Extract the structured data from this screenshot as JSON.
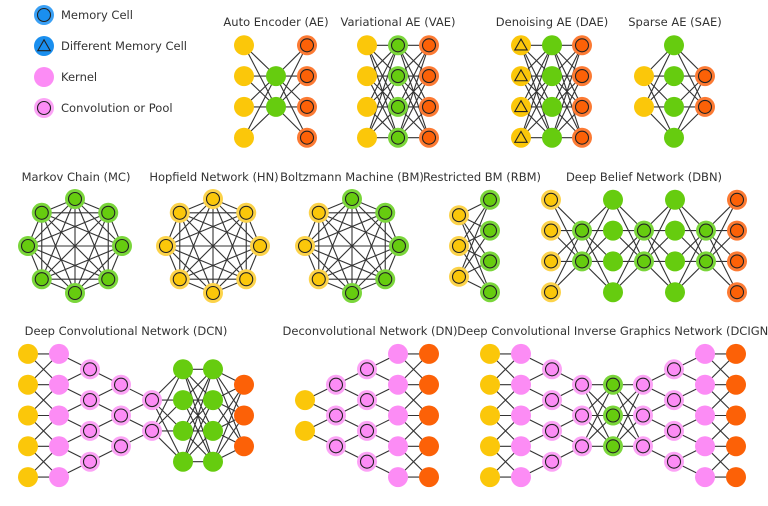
{
  "colors": {
    "memory": "#1a8fef",
    "memory_ring": "#3aa0f5",
    "kernel": "#fc8cf5",
    "conv_ring": "#fca3f6",
    "input": "#fbc70a",
    "hidden": "#66cc0f",
    "hidden_ring": "#7ad63a",
    "output": "#fc6107",
    "output_ring": "#fc7a33",
    "edge": "#333333",
    "text": "#333333"
  },
  "legend": [
    {
      "label": "Memory Cell",
      "type": "memory"
    },
    {
      "label": "Different Memory Cell",
      "type": "memory_tri"
    },
    {
      "label": "Kernel",
      "type": "kernel"
    },
    {
      "label": "Convolution or Pool",
      "type": "conv"
    }
  ],
  "networks": [
    {
      "id": "ae",
      "title": "Auto Encoder (AE)",
      "type": "layered",
      "layers": [
        {
          "type": "input",
          "count": 4
        },
        {
          "type": "hidden",
          "count": 2
        },
        {
          "type": "match_output",
          "count": 4
        }
      ]
    },
    {
      "id": "vae",
      "title": "Variational AE (VAE)",
      "type": "layered",
      "layers": [
        {
          "type": "input",
          "count": 4
        },
        {
          "type": "probabilistic_hidden",
          "count": 4
        },
        {
          "type": "match_output",
          "count": 4
        }
      ]
    },
    {
      "id": "dae",
      "title": "Denoising AE (DAE)",
      "type": "layered",
      "layers": [
        {
          "type": "noisy_input",
          "count": 4
        },
        {
          "type": "hidden",
          "count": 4
        },
        {
          "type": "match_output",
          "count": 4
        }
      ]
    },
    {
      "id": "sae",
      "title": "Sparse AE (SAE)",
      "type": "layered",
      "layers": [
        {
          "type": "input",
          "count": 2
        },
        {
          "type": "hidden",
          "count": 4
        },
        {
          "type": "match_output",
          "count": 2
        }
      ]
    },
    {
      "id": "mc",
      "title": "Markov Chain (MC)",
      "type": "ring",
      "nodes": [
        "probabilistic_hidden",
        "probabilistic_hidden",
        "probabilistic_hidden",
        "probabilistic_hidden",
        "probabilistic_hidden",
        "probabilistic_hidden",
        "probabilistic_hidden",
        "probabilistic_hidden"
      ]
    },
    {
      "id": "hn",
      "title": "Hopfield Network (HN)",
      "type": "ring",
      "nodes": [
        "backfed_input",
        "backfed_input",
        "backfed_input",
        "backfed_input",
        "backfed_input",
        "backfed_input",
        "backfed_input",
        "backfed_input"
      ]
    },
    {
      "id": "bm",
      "title": "Boltzmann Machine (BM)",
      "type": "ring",
      "nodes": [
        "probabilistic_hidden",
        "probabilistic_hidden",
        "probabilistic_hidden",
        "probabilistic_hidden",
        "probabilistic_hidden",
        "backfed_input",
        "backfed_input",
        "backfed_input"
      ]
    },
    {
      "id": "rbm",
      "title": "Restricted BM (RBM)",
      "type": "layered",
      "layers": [
        {
          "type": "backfed_input",
          "count": 3
        },
        {
          "type": "probabilistic_hidden",
          "count": 4
        }
      ]
    },
    {
      "id": "dbn",
      "title": "Deep Belief Network (DBN)",
      "type": "layered",
      "layers": [
        {
          "type": "backfed_input",
          "count": 4
        },
        {
          "type": "probabilistic_hidden",
          "count": 2
        },
        {
          "type": "hidden",
          "count": 4
        },
        {
          "type": "probabilistic_hidden",
          "count": 2
        },
        {
          "type": "hidden",
          "count": 4
        },
        {
          "type": "probabilistic_hidden",
          "count": 2
        },
        {
          "type": "match_output",
          "count": 4
        }
      ]
    },
    {
      "id": "dcn",
      "title": "Deep Convolutional Network (DCN)",
      "type": "layered",
      "layers": [
        {
          "type": "input",
          "count": 5
        },
        {
          "type": "kernel",
          "count": 5
        },
        {
          "type": "conv",
          "count": 4
        },
        {
          "type": "conv",
          "count": 3
        },
        {
          "type": "conv",
          "count": 2
        },
        {
          "type": "hidden",
          "count": 4
        },
        {
          "type": "hidden",
          "count": 4
        },
        {
          "type": "output",
          "count": 3
        }
      ]
    },
    {
      "id": "dn",
      "title": "Deconvolutional Network (DN)",
      "type": "layered",
      "layers": [
        {
          "type": "input",
          "count": 2
        },
        {
          "type": "conv",
          "count": 3
        },
        {
          "type": "conv",
          "count": 4
        },
        {
          "type": "kernel",
          "count": 5
        },
        {
          "type": "output",
          "count": 5
        }
      ]
    },
    {
      "id": "dcign",
      "title": "Deep Convolutional Inverse Graphics Network (DCIGN)",
      "type": "layered",
      "layers": [
        {
          "type": "input",
          "count": 5
        },
        {
          "type": "kernel",
          "count": 5
        },
        {
          "type": "conv",
          "count": 4
        },
        {
          "type": "conv",
          "count": 3
        },
        {
          "type": "probabilistic_hidden",
          "count": 3
        },
        {
          "type": "conv",
          "count": 3
        },
        {
          "type": "conv",
          "count": 4
        },
        {
          "type": "kernel",
          "count": 5
        },
        {
          "type": "output",
          "count": 5
        }
      ]
    }
  ]
}
